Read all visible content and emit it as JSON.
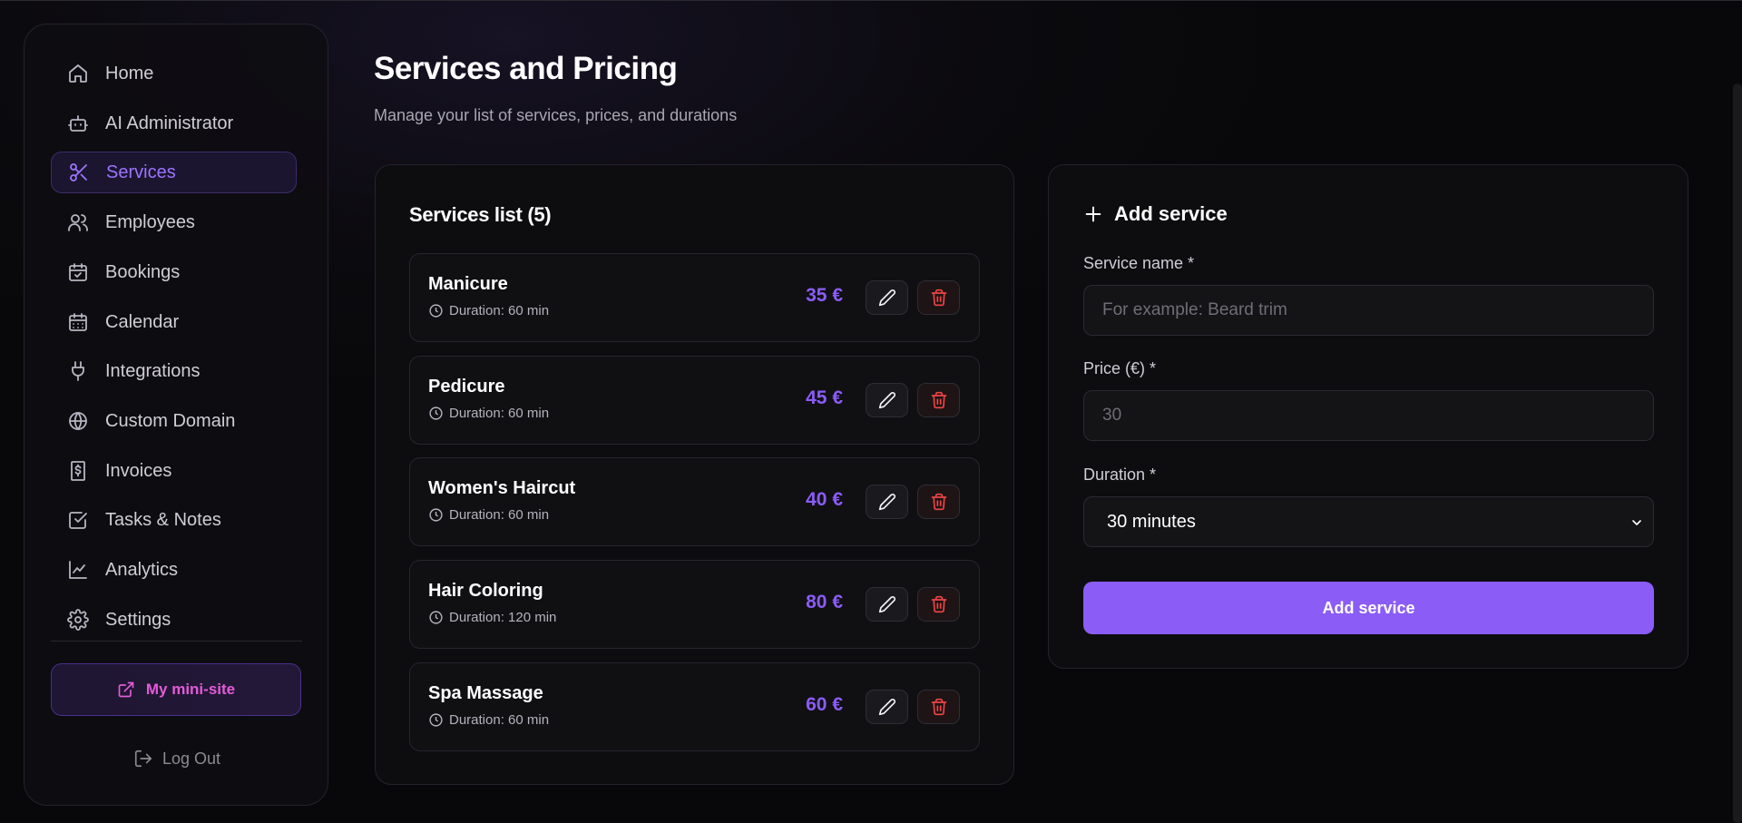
{
  "sidebar": {
    "items": [
      {
        "label": "Home",
        "icon": "home-icon",
        "active": false
      },
      {
        "label": "AI Administrator",
        "icon": "bot-icon",
        "active": false
      },
      {
        "label": "Services",
        "icon": "scissors-icon",
        "active": true
      },
      {
        "label": "Employees",
        "icon": "users-icon",
        "active": false
      },
      {
        "label": "Bookings",
        "icon": "calendar-check-icon",
        "active": false
      },
      {
        "label": "Calendar",
        "icon": "calendar-icon",
        "active": false
      },
      {
        "label": "Integrations",
        "icon": "plug-icon",
        "active": false
      },
      {
        "label": "Custom Domain",
        "icon": "globe-icon",
        "active": false
      },
      {
        "label": "Invoices",
        "icon": "receipt-icon",
        "active": false
      },
      {
        "label": "Tasks & Notes",
        "icon": "checkbox-icon",
        "active": false
      },
      {
        "label": "Analytics",
        "icon": "chart-line-icon",
        "active": false
      },
      {
        "label": "Settings",
        "icon": "gear-icon",
        "active": false
      }
    ],
    "mini_site_label": "My mini-site",
    "logout_label": "Log Out"
  },
  "header": {
    "title": "Services and Pricing",
    "subtitle": "Manage your list of services, prices, and durations"
  },
  "services_list": {
    "title": "Services list (5)",
    "items": [
      {
        "name": "Manicure",
        "duration": "Duration: 60 min",
        "price": "35 €"
      },
      {
        "name": "Pedicure",
        "duration": "Duration: 60 min",
        "price": "45 €"
      },
      {
        "name": "Women's Haircut",
        "duration": "Duration: 60 min",
        "price": "40 €"
      },
      {
        "name": "Hair Coloring",
        "duration": "Duration: 120 min",
        "price": "80 €"
      },
      {
        "name": "Spa Massage",
        "duration": "Duration: 60 min",
        "price": "60 €"
      }
    ]
  },
  "add_form": {
    "title": "Add service",
    "name_label": "Service name *",
    "name_placeholder": "For example: Beard trim",
    "name_value": "",
    "price_label": "Price (€) *",
    "price_placeholder": "30",
    "price_value": "",
    "duration_label": "Duration *",
    "duration_value": "30 minutes",
    "submit_label": "Add service"
  },
  "colors": {
    "accent": "#8b5cf6",
    "mini_site": "#e35bd9",
    "danger": "#ef4444",
    "background": "#0b0a0e"
  }
}
